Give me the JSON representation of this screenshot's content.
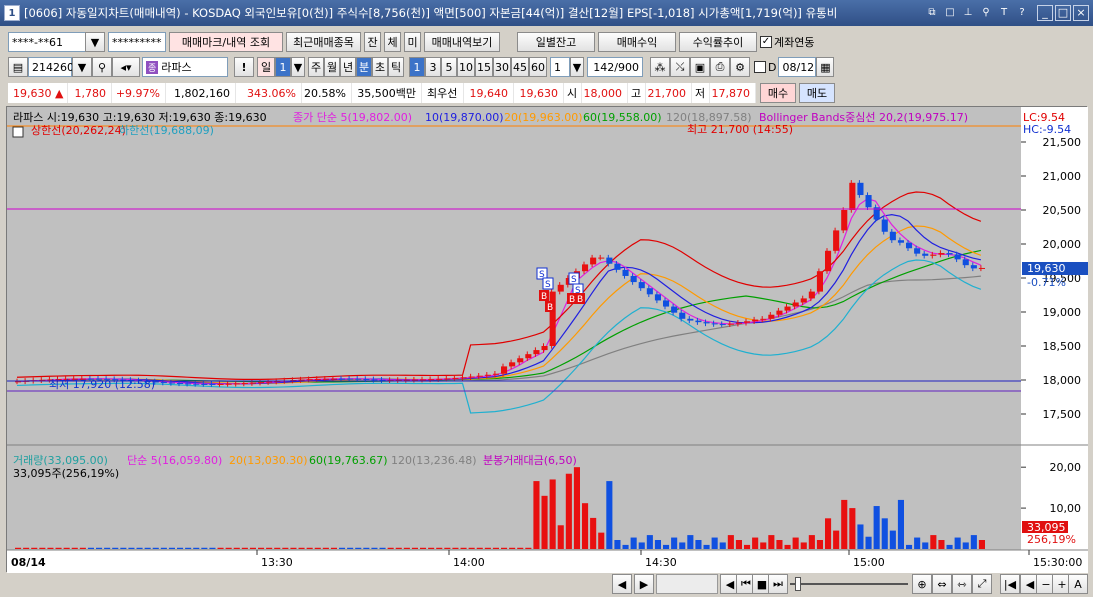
{
  "window": {
    "num": "1",
    "title": "[0606] 자동일지차트(매매내역) - KOSDAQ 외국인보유[0(천)] 주식수[8,756(천)] 액면[500] 자본금[44(억)] 결산[12월] EPS[-1,018] 시가총액[1,719(억)] 유통비"
  },
  "toolbar1": {
    "account": "****-**61",
    "password": "*********",
    "btn_mark": "매매마크/내역 조회",
    "btn_recent": "최근매매종목",
    "btn_jan": "잔",
    "btn_che": "체",
    "btn_mi": "미",
    "btn_history": "매매내역보기",
    "btn_daily": "일별잔고",
    "btn_profit": "매매수익",
    "btn_trend": "수익률추이",
    "link_label": "계좌연동"
  },
  "toolbar2": {
    "code": "214260",
    "name": "라파스",
    "period_il": "일",
    "period_num": "1",
    "periods": [
      "주",
      "월",
      "년",
      "분",
      "초",
      "틱"
    ],
    "intervals": [
      "1",
      "3",
      "5",
      "10",
      "15",
      "30",
      "45",
      "60"
    ],
    "count_sel": "1",
    "bars": "142/900",
    "d_label": "D",
    "date": "08/12"
  },
  "quote": {
    "price": "19,630",
    "arrow": "▲",
    "change": "1,780",
    "pct": "+9.97%",
    "volume": "1,802,160",
    "vol_ratio": "343.06%",
    "turnover": "20.58%",
    "amount": "35,500백만",
    "best_label": "최우선",
    "ask": "19,640",
    "bid": "19,630",
    "open_label": "시",
    "open": "18,000",
    "high_label": "고",
    "high": "21,700",
    "low_label": "저",
    "low": "17,870",
    "buy": "매수",
    "sell": "매도"
  },
  "legend": {
    "line1a": "라파스 시:19,630 고:19,630 저:19,630 종:19,630",
    "ma5": "종가 단순 5(19,802.00)",
    "ma10": "10(19,870.00)",
    "ma20": "20(19,963.00)",
    "ma60": "60(19,558.00)",
    "ma120": "120(18,897.58)",
    "bb": "Bollinger Bands중심선 20,2(19,975.17)",
    "upper": "상한선(20,262,24)",
    "lower": "하한선(19,688,09)",
    "lc": "LC:9.54",
    "hc": "HC:-9.54"
  },
  "annotations": {
    "high": "최고 21,700 (14:55)",
    "low": "최저 17,920 (12:58)"
  },
  "price_axis": {
    "ticks": [
      "21,500",
      "21,000",
      "20,500",
      "20,000",
      "19,500",
      "19,000",
      "18,500",
      "18,000",
      "17,500"
    ],
    "current": "19,630",
    "current_pct": "-0.71%"
  },
  "volume_legend": {
    "vol": "거래량(33,095.00)",
    "ma5": "단순 5(16,059.80)",
    "ma20": "20(13,030.30)",
    "ma60": "60(19,763.67)",
    "ma120": "120(13,236.48)",
    "amount": "분봉거래대금(6,50)",
    "sub": "33,095주(256,19%)"
  },
  "volume_axis": {
    "ticks": [
      "20,00",
      "10,00"
    ],
    "current": "33,095",
    "current_pct": "256,19%"
  },
  "time_axis": {
    "date": "08/14",
    "ticks": [
      "13:30",
      "14:00",
      "14:30",
      "15:00",
      "15:30:00"
    ]
  },
  "colors": {
    "up": "#e81010",
    "down": "#1050e0",
    "ma5": "#e020e0",
    "ma10": "#2020e0",
    "ma20": "#ff9a00",
    "ma60": "#00a000",
    "ma120": "#808080",
    "bb_mid": "#e0e000",
    "bb_upper": "#e00000",
    "bb_lower": "#20b0d0"
  }
}
